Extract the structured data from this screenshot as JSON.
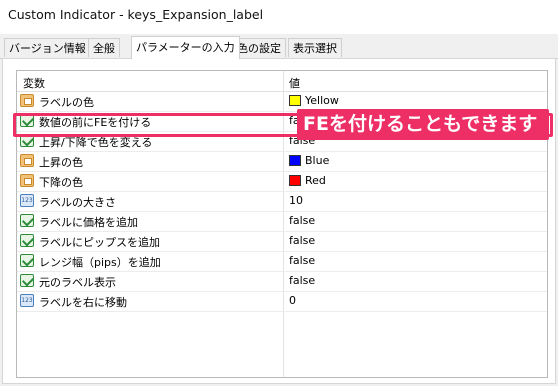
{
  "window": {
    "title": "Custom Indicator - keys_Expansion_label"
  },
  "tabs": [
    {
      "label": "バージョン情報",
      "active": false
    },
    {
      "label": "全般",
      "active": false
    },
    {
      "label": "パラメーターの入力",
      "active": true
    },
    {
      "label": "色の設定",
      "active": false
    },
    {
      "label": "表示選択",
      "active": false
    }
  ],
  "table": {
    "col_variable": "変数",
    "col_value": "値",
    "rows": [
      {
        "name": "ラベルの色",
        "value": "Yellow",
        "type": "color",
        "swatch": "#ffff00"
      },
      {
        "name": "数値の前にFEを付ける",
        "value": "false",
        "type": "bool"
      },
      {
        "name": "上昇/下降で色を変える",
        "value": "false",
        "type": "bool"
      },
      {
        "name": "上昇の色",
        "value": "Blue",
        "type": "color",
        "swatch": "#0000ff"
      },
      {
        "name": "下降の色",
        "value": "Red",
        "type": "color",
        "swatch": "#ff0000"
      },
      {
        "name": "ラベルの大きさ",
        "value": "10",
        "type": "int"
      },
      {
        "name": "ラベルに価格を追加",
        "value": "false",
        "type": "bool"
      },
      {
        "name": "ラベルにピップスを追加",
        "value": "false",
        "type": "bool"
      },
      {
        "name": "レンジ幅（pips）を追加",
        "value": "false",
        "type": "bool"
      },
      {
        "name": "元のラベル表示",
        "value": "false",
        "type": "bool"
      },
      {
        "name": "ラベルを右に移動",
        "value": "0",
        "type": "int"
      }
    ]
  },
  "annotation": {
    "callout_text": "FEを付けることもできます",
    "accent": "#ee2f66"
  }
}
